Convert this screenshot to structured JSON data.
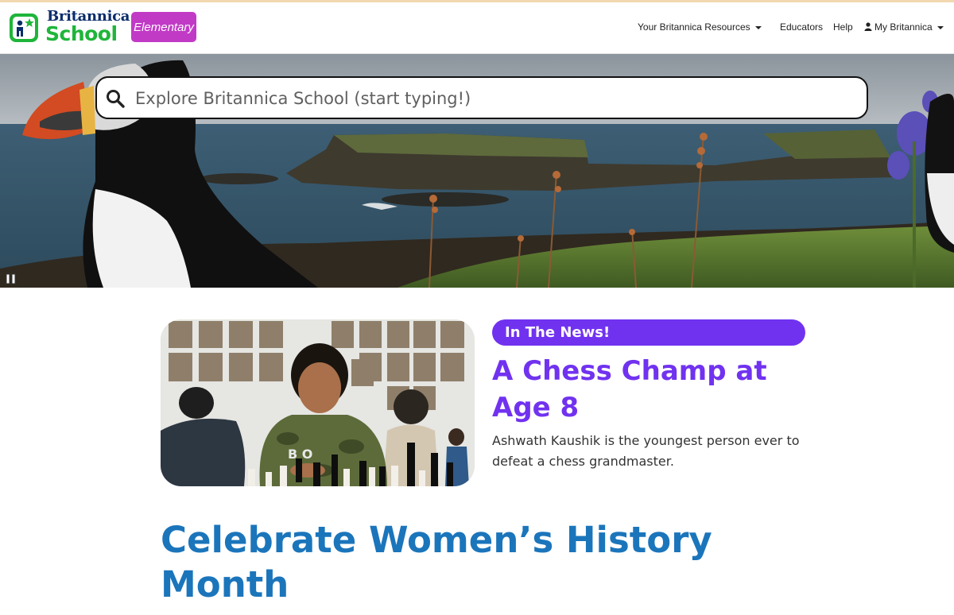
{
  "header": {
    "logo_top": "Britannica",
    "logo_bottom": "School",
    "logo_badge": "Elementary",
    "nav": {
      "resources": "Your Britannica Resources",
      "educators": "Educators",
      "help": "Help",
      "my_britannica": "My Britannica"
    }
  },
  "search": {
    "placeholder": "Explore Britannica School (start typing!)"
  },
  "news": {
    "label": "In The News!",
    "title": "A Chess Champ at Age 8",
    "description": "Ashwath Kaushik is the youngest person ever to defeat a chess grandmaster."
  },
  "feature": {
    "title": "Celebrate Women’s History Month"
  },
  "colors": {
    "brand_green": "#1fb53a",
    "brand_navy": "#0c2d6b",
    "badge_magenta": "#c13ac6",
    "news_purple": "#7132f0",
    "feature_blue": "#1b75bb"
  }
}
